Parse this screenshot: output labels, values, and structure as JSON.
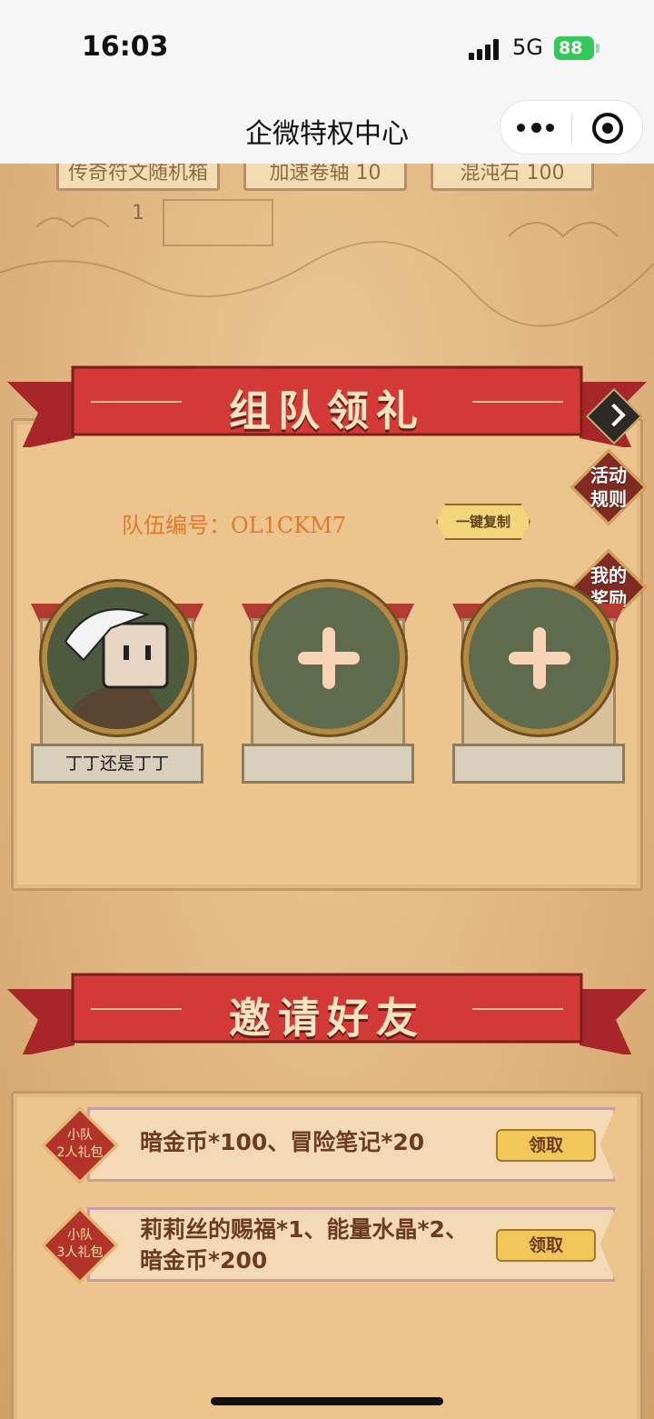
{
  "status": {
    "time": "16:03",
    "network": "5G",
    "battery": "88"
  },
  "nav": {
    "title": "企微特权中心",
    "more_icon": "more-icon",
    "close_icon": "target-icon"
  },
  "top_tabs": [
    "传奇符文随机箱 1",
    "加速卷轴 10",
    "混沌石 100"
  ],
  "team": {
    "title": "组队领礼",
    "team_id_label": "队伍编号：OL1CKM7",
    "copy_button": "一键复制",
    "side_rules": "活动\n规则",
    "side_rewards": "我的\n奖励",
    "members": [
      {
        "name": "丁丁还是丁丁",
        "filled": true
      },
      {
        "name": "",
        "filled": false
      },
      {
        "name": "",
        "filled": false
      }
    ]
  },
  "invite": {
    "title": "邀请好友",
    "rewards": [
      {
        "badge": "小队\n2人礼包",
        "desc": "暗金币*100、冒险笔记*20",
        "button": "领取"
      },
      {
        "badge": "小队\n3人礼包",
        "desc": "莉莉丝的赐福*1、能量水晶*2、\n暗金币*200",
        "button": "领取"
      }
    ]
  },
  "colors": {
    "ribbon": "#d33a37",
    "accent_orange": "#e07a2a",
    "panel": "#ebc48e"
  }
}
